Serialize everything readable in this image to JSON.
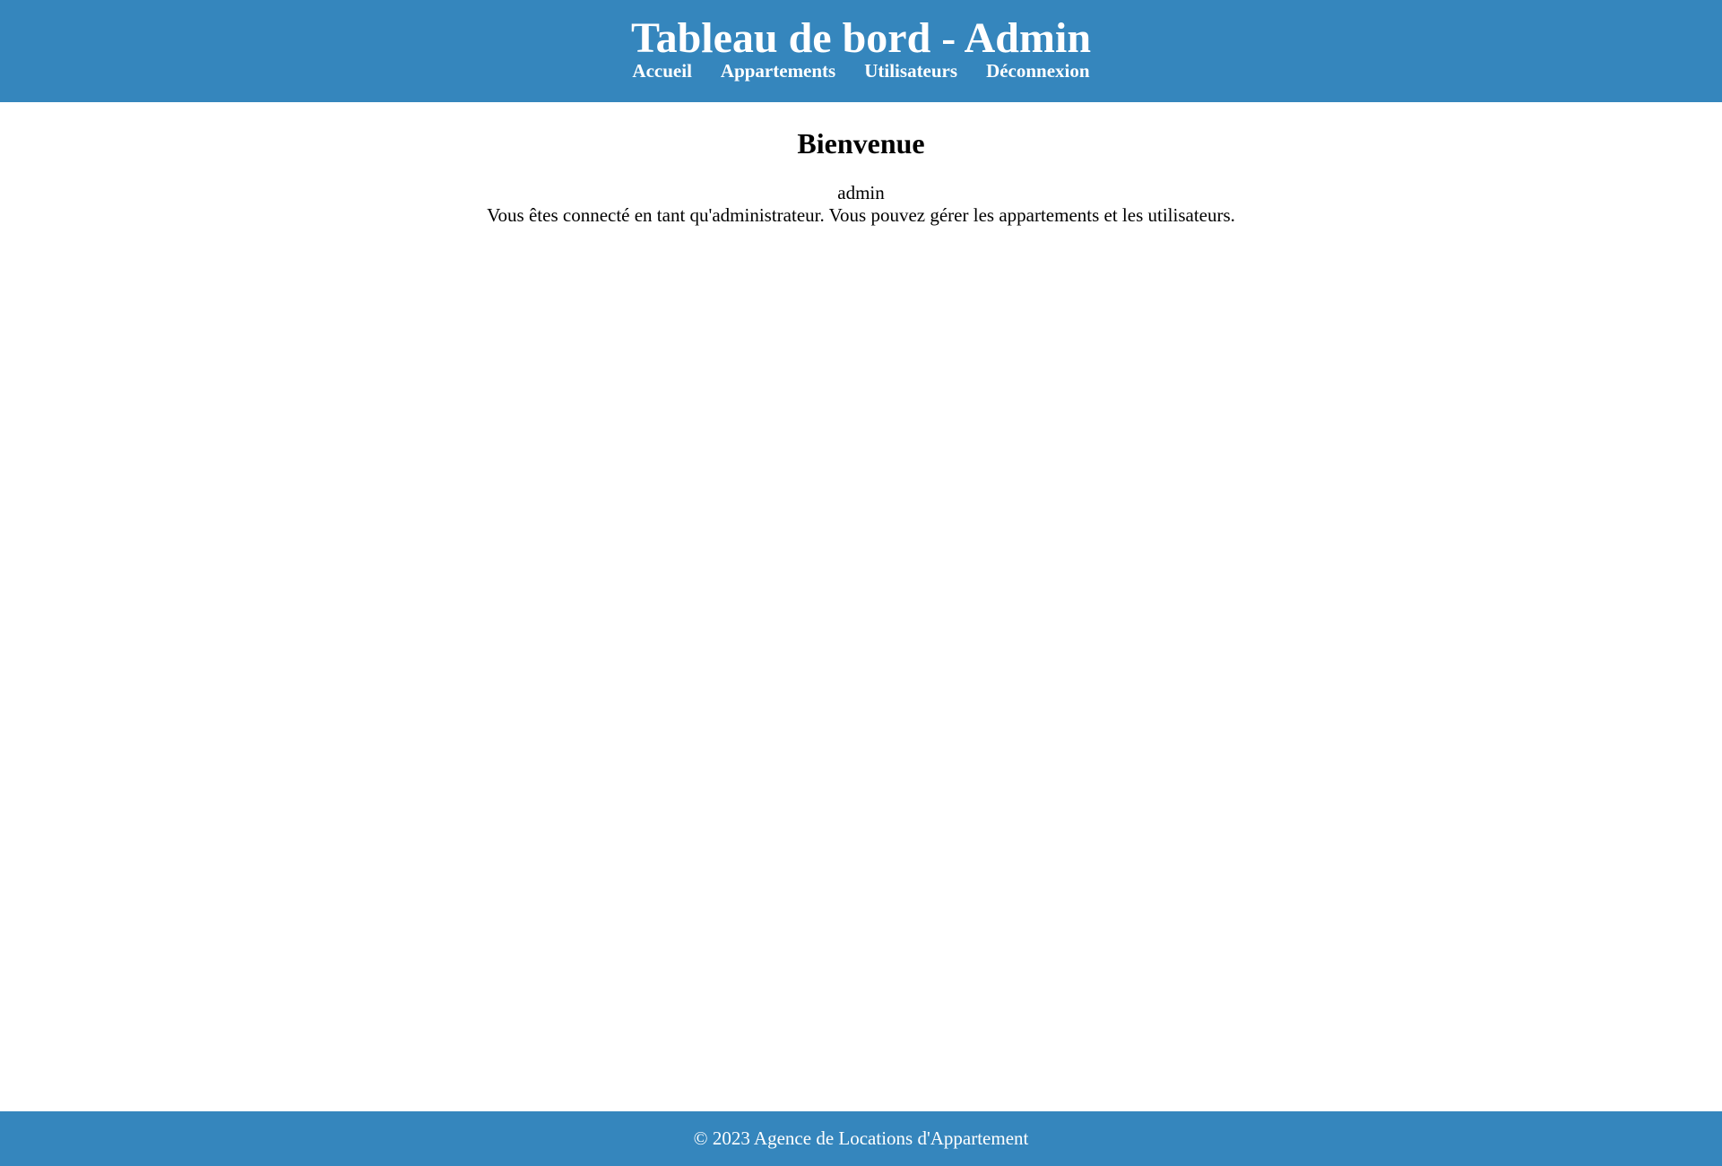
{
  "header": {
    "title": "Tableau de bord - Admin",
    "background_color": "#3586bd",
    "nav": [
      {
        "label": "Accueil"
      },
      {
        "label": "Appartements"
      },
      {
        "label": "Utilisateurs"
      },
      {
        "label": "Déconnexion"
      }
    ]
  },
  "main": {
    "heading": "Bienvenue",
    "username": "admin",
    "message": "Vous êtes connecté en tant qu'administrateur. Vous pouvez gérer les appartements et les utilisateurs."
  },
  "footer": {
    "copyright": "© 2023 Agence de Locations d'Appartement",
    "background_color": "#3586bd"
  }
}
